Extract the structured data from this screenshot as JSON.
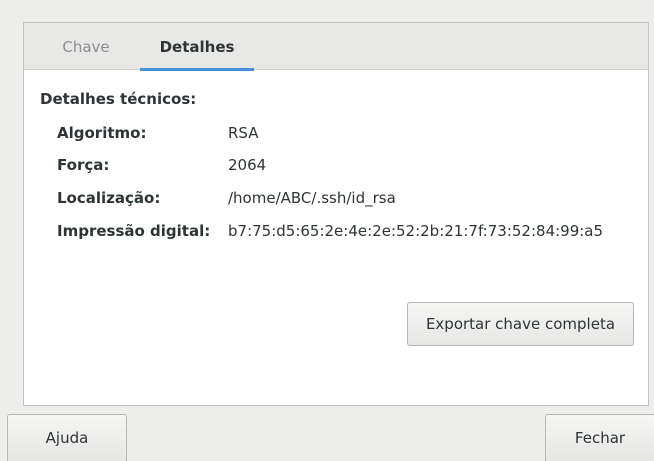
{
  "tabs": [
    {
      "label": "Chave",
      "active": false
    },
    {
      "label": "Detalhes",
      "active": true
    }
  ],
  "details": {
    "section_title": "Detalhes técnicos:",
    "rows": [
      {
        "label": "Algoritmo:",
        "value": "RSA"
      },
      {
        "label": "Força:",
        "value": "2064"
      },
      {
        "label": "Localização:",
        "value": "/home/ABC/.ssh/id_rsa"
      },
      {
        "label": "Impressão digital:",
        "value": "b7:75:d5:65:2e:4e:2e:52:2b:21:7f:73:52:84:99:a5"
      }
    ],
    "export_button": "Exportar chave completa"
  },
  "footer": {
    "help_button": "Ajuda",
    "close_button": "Fechar"
  },
  "colors": {
    "accent": "#4a90d9",
    "background": "#ededeb",
    "content_bg": "#ffffff"
  }
}
